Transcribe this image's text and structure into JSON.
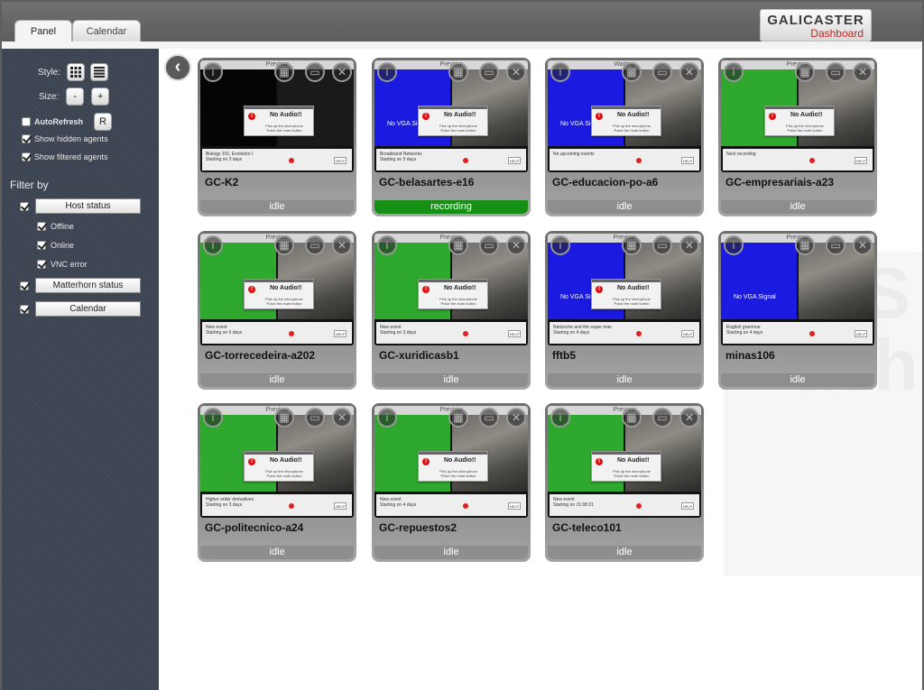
{
  "tabs": [
    {
      "label": "Panel",
      "active": true
    },
    {
      "label": "Calendar",
      "active": false
    }
  ],
  "brand": {
    "line1": "GALICASTER",
    "line2": "Dashboard"
  },
  "sidebar": {
    "style_label": "Style:",
    "size_label": "Size:",
    "size_minus": "-",
    "size_plus": "+",
    "autorefresh_label": "AutoRefresh",
    "autorefresh_btn": "R",
    "show_hidden_label": "Show hidden agents",
    "show_filtered_label": "Show filtered agents",
    "filter_by": "Filter by",
    "host_status": "Host status",
    "offline": "Offline",
    "online": "Online",
    "vnc_error": "VNC error",
    "matterhorn_status": "Matterhorn status",
    "calendar": "Calendar"
  },
  "watermark": {
    "line1": "ICAS",
    "line2": "Dash"
  },
  "agents": [
    {
      "name": "GC-K2",
      "status": "idle",
      "left": "black",
      "right": "dark",
      "header": "Preview",
      "dialog": true,
      "footer": [
        "Biology 101: Evolution I",
        "Starting on 3 days"
      ],
      "novga": ""
    },
    {
      "name": "GC-belasartes-e16",
      "status": "recording",
      "left": "blue",
      "right": "room",
      "header": "Preview",
      "dialog": true,
      "footer": [
        "Broadband Networks",
        "Starting on 5 days"
      ],
      "novga": "No VGA Signal"
    },
    {
      "name": "GC-educacion-po-a6",
      "status": "idle",
      "left": "blue",
      "right": "room",
      "header": "Waiting",
      "dialog": true,
      "footer": [
        "No upcoming events",
        ""
      ],
      "novga": "No VGA Signal"
    },
    {
      "name": "GC-empresariais-a23",
      "status": "idle",
      "left": "green",
      "right": "room",
      "header": "Preview",
      "dialog": true,
      "footer": [
        "Next recording",
        ""
      ],
      "novga": ""
    },
    {
      "name": "GC-torrecedeira-a202",
      "status": "idle",
      "left": "green",
      "right": "room",
      "header": "Preview",
      "dialog": true,
      "footer": [
        "New event",
        "Starting on 6 days"
      ],
      "novga": ""
    },
    {
      "name": "GC-xuridicasb1",
      "status": "idle",
      "left": "green",
      "right": "room",
      "header": "Preview",
      "dialog": true,
      "footer": [
        "New event",
        "Starting on 3 days"
      ],
      "novga": ""
    },
    {
      "name": "fftb5",
      "status": "idle",
      "left": "blue",
      "right": "room",
      "header": "Preview",
      "dialog": true,
      "footer": [
        "Nietzsche and the super man",
        "Starting on 4 days"
      ],
      "novga": "No VGA Signal"
    },
    {
      "name": "minas106",
      "status": "idle",
      "left": "blue",
      "right": "room",
      "header": "Preview",
      "dialog": false,
      "footer": [
        "English grammar",
        "Starting on 4 days"
      ],
      "novga": "No VGA Signal"
    },
    {
      "name": "GC-politecnico-a24",
      "status": "idle",
      "left": "green",
      "right": "room",
      "header": "Preview",
      "dialog": true,
      "footer": [
        "Higher order derivatives",
        "Starting on 3 days"
      ],
      "novga": ""
    },
    {
      "name": "GC-repuestos2",
      "status": "idle",
      "left": "green",
      "right": "room",
      "header": "Preview",
      "dialog": true,
      "footer": [
        "New event",
        "Starting on 4 days"
      ],
      "novga": ""
    },
    {
      "name": "GC-teleco101",
      "status": "idle",
      "left": "green",
      "right": "room",
      "header": "Preview",
      "dialog": true,
      "footer": [
        "New event",
        "Starting on 21:08:21"
      ],
      "novga": ""
    }
  ],
  "dialog": {
    "title": "No Audio!!",
    "line1": "Pick up the microphone",
    "line2": "Pulse the mute button"
  },
  "help_label": "HELP",
  "colors": {
    "recording": "#159015",
    "idle": "#8e8e8e",
    "green": "#2fa82f",
    "blue": "#1a1ae0"
  }
}
